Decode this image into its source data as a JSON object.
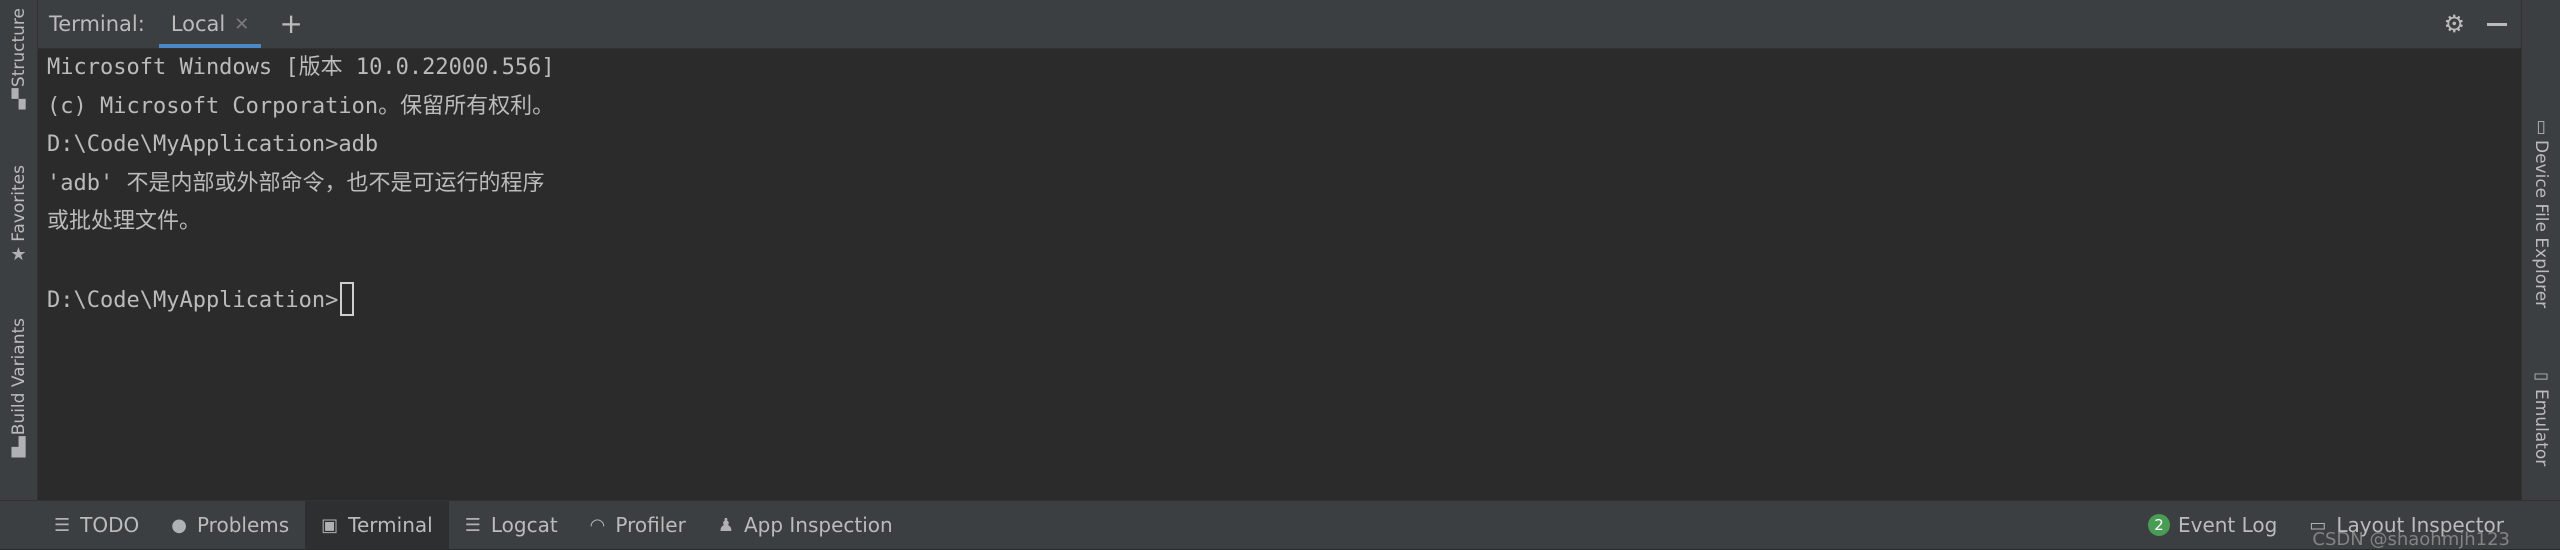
{
  "left_strip": {
    "tabs": [
      {
        "label": "Structure",
        "icon": "structure-icon"
      },
      {
        "label": "Favorites",
        "icon": "star-icon"
      },
      {
        "label": "Build Variants",
        "icon": "android-icon"
      }
    ]
  },
  "right_strip": {
    "tabs": [
      {
        "label": "Device File Explorer",
        "icon": "phone-icon"
      },
      {
        "label": "Emulator",
        "icon": "emulator-icon"
      }
    ]
  },
  "terminal": {
    "title": "Terminal:",
    "tab_label": "Local",
    "lines": [
      "Microsoft Windows [版本 10.0.22000.556]",
      "(c) Microsoft Corporation。保留所有权利。",
      "D:\\Code\\MyApplication>adb",
      "'adb' 不是内部或外部命令，也不是可运行的程序",
      "或批处理文件。",
      "",
      "D:\\Code\\MyApplication>"
    ]
  },
  "bottom_bar": {
    "tabs": [
      {
        "label": "TODO",
        "icon": "list-icon"
      },
      {
        "label": "Problems",
        "icon": "info-icon"
      },
      {
        "label": "Terminal",
        "icon": "terminal-icon"
      },
      {
        "label": "Logcat",
        "icon": "logcat-icon"
      },
      {
        "label": "Profiler",
        "icon": "gauge-icon"
      },
      {
        "label": "App Inspection",
        "icon": "inspection-icon"
      }
    ],
    "active_tab": "Terminal",
    "event_log_count": "2",
    "event_log_label": "Event Log",
    "layout_inspector_label": "Layout Inspector"
  },
  "watermark": "CSDN @shaohmjh123",
  "colors": {
    "background": "#2b2b2b",
    "panel": "#3c3f41",
    "accent": "#4a88c7",
    "badge": "#499c54"
  }
}
